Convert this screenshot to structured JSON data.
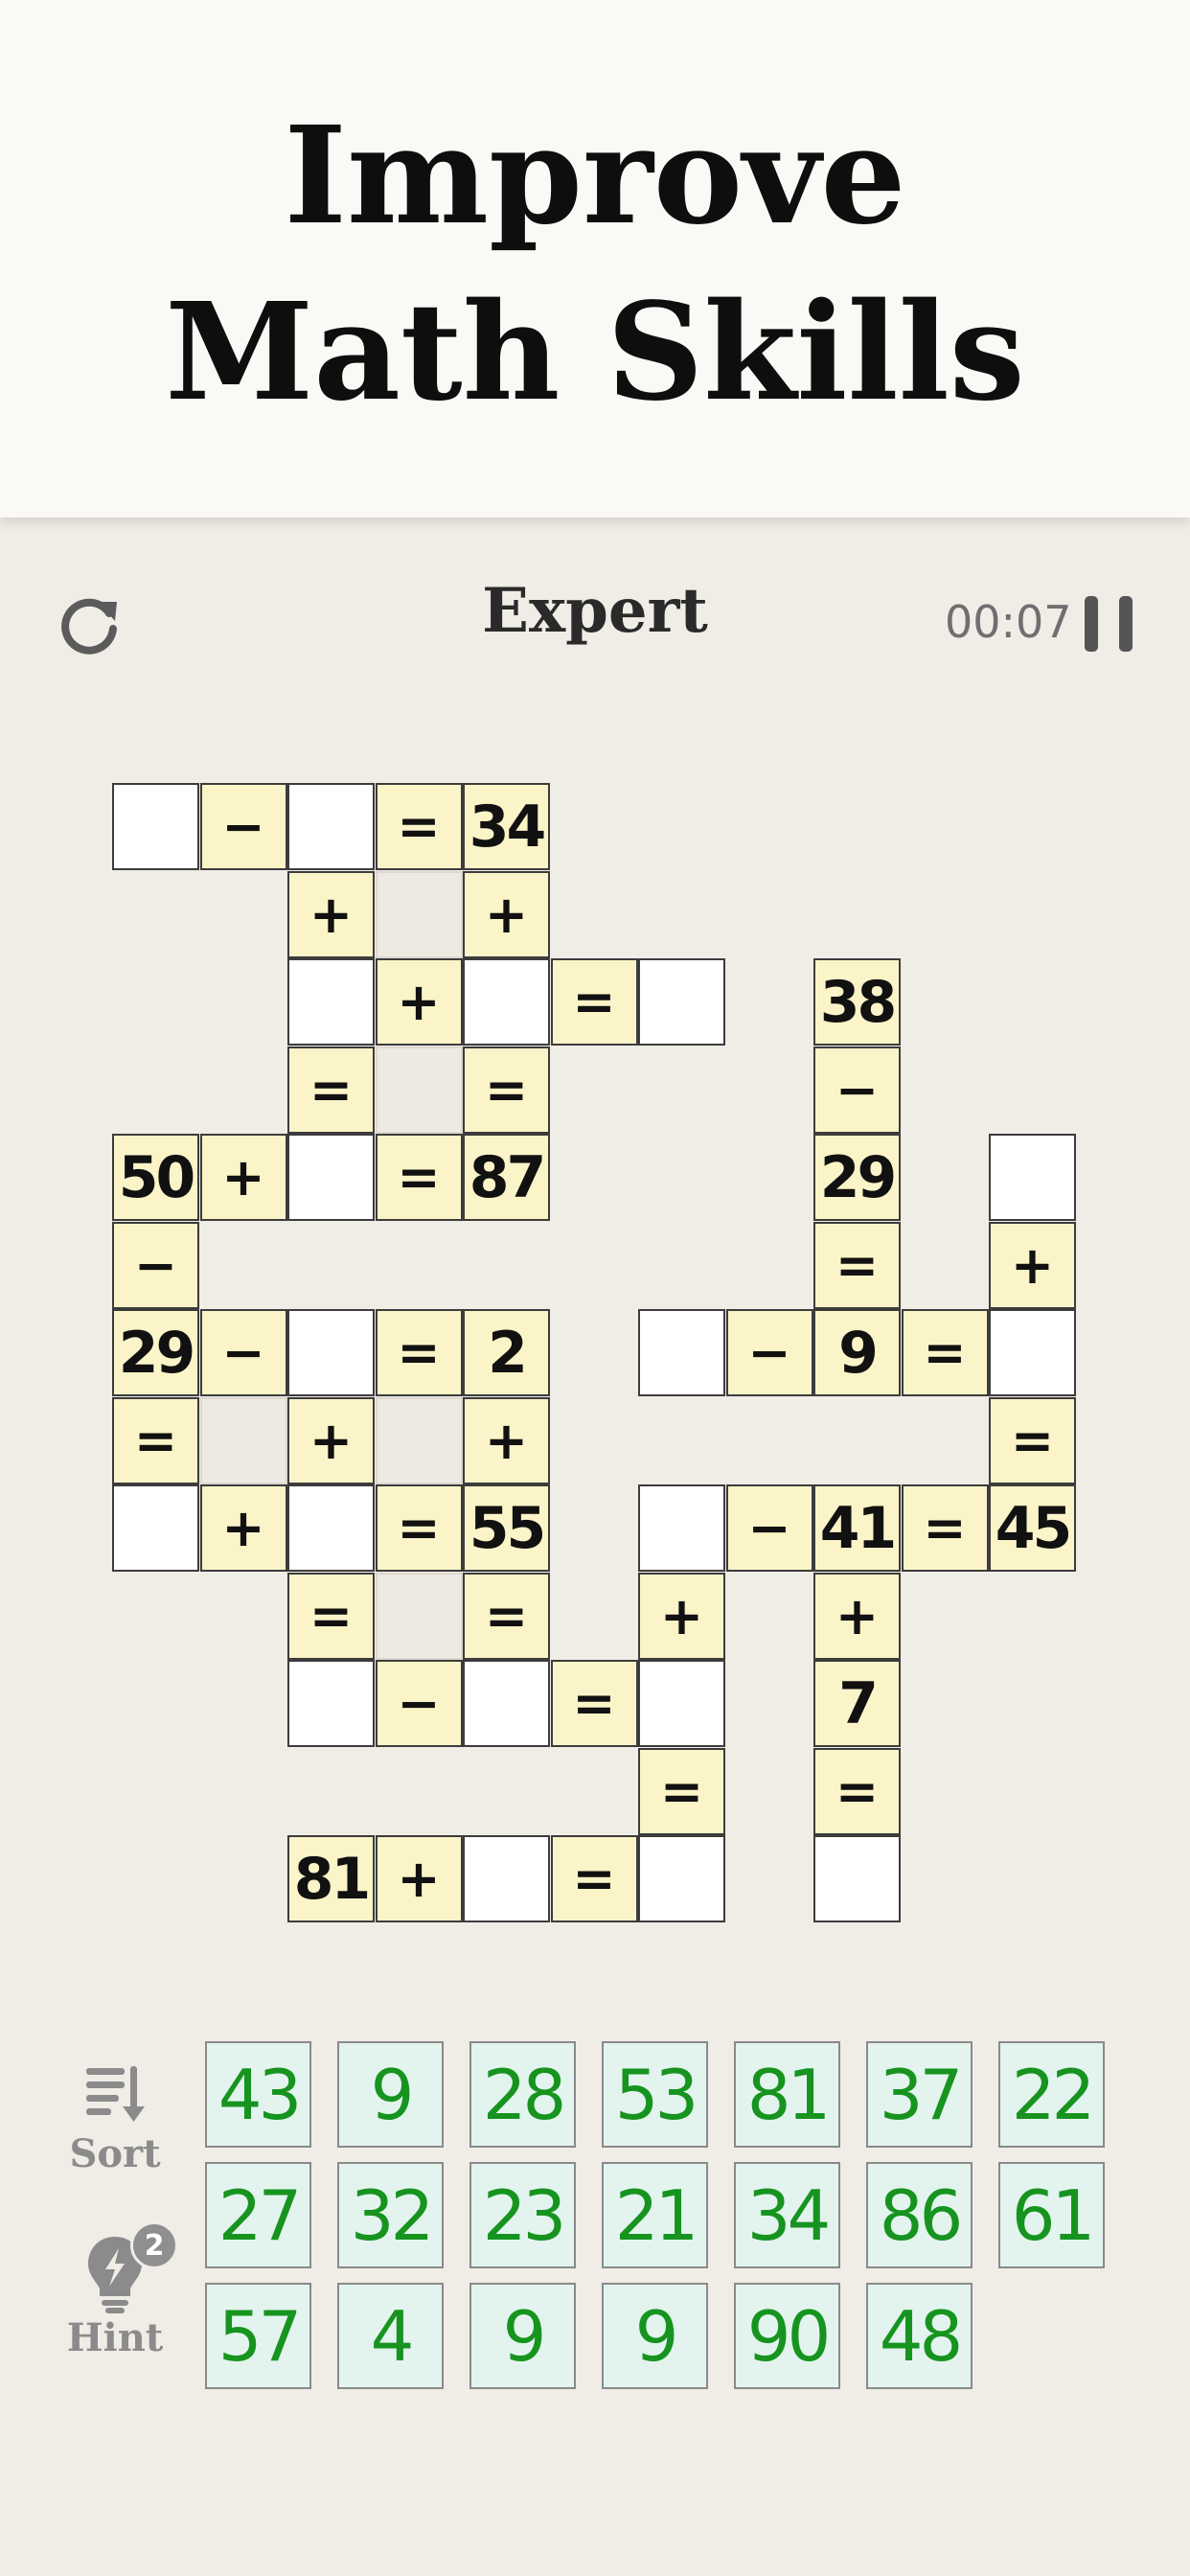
{
  "banner": {
    "line1": "Improve",
    "line2": "Math Skills"
  },
  "header": {
    "level": "Expert",
    "timer": "00:07",
    "restart_icon": "refresh-icon",
    "pause_icon": "pause-icon"
  },
  "tools": {
    "sort_label": "Sort",
    "hint_label": "Hint",
    "hint_count": "2",
    "sort_icon": "sort-icon",
    "hint_icon": "lightbulb-icon"
  },
  "colors": {
    "tile_text": "#17941f",
    "tile_bg": "#e3f4ef",
    "clue_bg": "#fbf4c8",
    "background": "#f0ece6"
  },
  "grid": {
    "rows": 13,
    "cols": 11,
    "cells": [
      {
        "r": 0,
        "c": 0,
        "t": "e"
      },
      {
        "r": 0,
        "c": 1,
        "t": "o",
        "v": "−"
      },
      {
        "r": 0,
        "c": 2,
        "t": "e"
      },
      {
        "r": 0,
        "c": 3,
        "t": "o",
        "v": "="
      },
      {
        "r": 0,
        "c": 4,
        "t": "n",
        "v": "34"
      },
      {
        "r": 1,
        "c": 2,
        "t": "o",
        "v": "+"
      },
      {
        "r": 1,
        "c": 3,
        "t": "b"
      },
      {
        "r": 1,
        "c": 4,
        "t": "o",
        "v": "+"
      },
      {
        "r": 2,
        "c": 2,
        "t": "e"
      },
      {
        "r": 2,
        "c": 3,
        "t": "o",
        "v": "+"
      },
      {
        "r": 2,
        "c": 4,
        "t": "e"
      },
      {
        "r": 2,
        "c": 5,
        "t": "o",
        "v": "="
      },
      {
        "r": 2,
        "c": 6,
        "t": "e"
      },
      {
        "r": 2,
        "c": 8,
        "t": "n",
        "v": "38"
      },
      {
        "r": 3,
        "c": 2,
        "t": "o",
        "v": "="
      },
      {
        "r": 3,
        "c": 3,
        "t": "b"
      },
      {
        "r": 3,
        "c": 4,
        "t": "o",
        "v": "="
      },
      {
        "r": 3,
        "c": 8,
        "t": "o",
        "v": "−"
      },
      {
        "r": 4,
        "c": 0,
        "t": "n",
        "v": "50"
      },
      {
        "r": 4,
        "c": 1,
        "t": "o",
        "v": "+"
      },
      {
        "r": 4,
        "c": 2,
        "t": "e"
      },
      {
        "r": 4,
        "c": 3,
        "t": "o",
        "v": "="
      },
      {
        "r": 4,
        "c": 4,
        "t": "n",
        "v": "87"
      },
      {
        "r": 4,
        "c": 8,
        "t": "n",
        "v": "29"
      },
      {
        "r": 4,
        "c": 10,
        "t": "e"
      },
      {
        "r": 5,
        "c": 0,
        "t": "o",
        "v": "−"
      },
      {
        "r": 5,
        "c": 8,
        "t": "o",
        "v": "="
      },
      {
        "r": 5,
        "c": 10,
        "t": "o",
        "v": "+"
      },
      {
        "r": 6,
        "c": 0,
        "t": "n",
        "v": "29"
      },
      {
        "r": 6,
        "c": 1,
        "t": "o",
        "v": "−"
      },
      {
        "r": 6,
        "c": 2,
        "t": "e"
      },
      {
        "r": 6,
        "c": 3,
        "t": "o",
        "v": "="
      },
      {
        "r": 6,
        "c": 4,
        "t": "n",
        "v": "2"
      },
      {
        "r": 6,
        "c": 6,
        "t": "e"
      },
      {
        "r": 6,
        "c": 7,
        "t": "o",
        "v": "−"
      },
      {
        "r": 6,
        "c": 8,
        "t": "n",
        "v": "9"
      },
      {
        "r": 6,
        "c": 9,
        "t": "o",
        "v": "="
      },
      {
        "r": 6,
        "c": 10,
        "t": "e"
      },
      {
        "r": 7,
        "c": 0,
        "t": "o",
        "v": "="
      },
      {
        "r": 7,
        "c": 1,
        "t": "b"
      },
      {
        "r": 7,
        "c": 2,
        "t": "o",
        "v": "+"
      },
      {
        "r": 7,
        "c": 3,
        "t": "b"
      },
      {
        "r": 7,
        "c": 4,
        "t": "o",
        "v": "+"
      },
      {
        "r": 7,
        "c": 10,
        "t": "o",
        "v": "="
      },
      {
        "r": 8,
        "c": 0,
        "t": "e"
      },
      {
        "r": 8,
        "c": 1,
        "t": "o",
        "v": "+"
      },
      {
        "r": 8,
        "c": 2,
        "t": "e"
      },
      {
        "r": 8,
        "c": 3,
        "t": "o",
        "v": "="
      },
      {
        "r": 8,
        "c": 4,
        "t": "n",
        "v": "55"
      },
      {
        "r": 8,
        "c": 6,
        "t": "e"
      },
      {
        "r": 8,
        "c": 7,
        "t": "o",
        "v": "−"
      },
      {
        "r": 8,
        "c": 8,
        "t": "n",
        "v": "41"
      },
      {
        "r": 8,
        "c": 9,
        "t": "o",
        "v": "="
      },
      {
        "r": 8,
        "c": 10,
        "t": "n",
        "v": "45"
      },
      {
        "r": 9,
        "c": 2,
        "t": "o",
        "v": "="
      },
      {
        "r": 9,
        "c": 3,
        "t": "b"
      },
      {
        "r": 9,
        "c": 4,
        "t": "o",
        "v": "="
      },
      {
        "r": 9,
        "c": 6,
        "t": "o",
        "v": "+"
      },
      {
        "r": 9,
        "c": 8,
        "t": "o",
        "v": "+"
      },
      {
        "r": 10,
        "c": 2,
        "t": "e"
      },
      {
        "r": 10,
        "c": 3,
        "t": "o",
        "v": "−"
      },
      {
        "r": 10,
        "c": 4,
        "t": "e"
      },
      {
        "r": 10,
        "c": 5,
        "t": "o",
        "v": "="
      },
      {
        "r": 10,
        "c": 6,
        "t": "e"
      },
      {
        "r": 10,
        "c": 8,
        "t": "n",
        "v": "7"
      },
      {
        "r": 11,
        "c": 6,
        "t": "o",
        "v": "="
      },
      {
        "r": 11,
        "c": 8,
        "t": "o",
        "v": "="
      },
      {
        "r": 12,
        "c": 2,
        "t": "n",
        "v": "81"
      },
      {
        "r": 12,
        "c": 3,
        "t": "o",
        "v": "+"
      },
      {
        "r": 12,
        "c": 4,
        "t": "e"
      },
      {
        "r": 12,
        "c": 5,
        "t": "o",
        "v": "="
      },
      {
        "r": 12,
        "c": 6,
        "t": "e"
      },
      {
        "r": 12,
        "c": 8,
        "t": "e"
      }
    ]
  },
  "tiles": [
    [
      "43",
      "9",
      "28",
      "53",
      "81",
      "37",
      "22"
    ],
    [
      "27",
      "32",
      "23",
      "21",
      "34",
      "86",
      "61"
    ],
    [
      "57",
      "4",
      "9",
      "9",
      "90",
      "48"
    ]
  ]
}
